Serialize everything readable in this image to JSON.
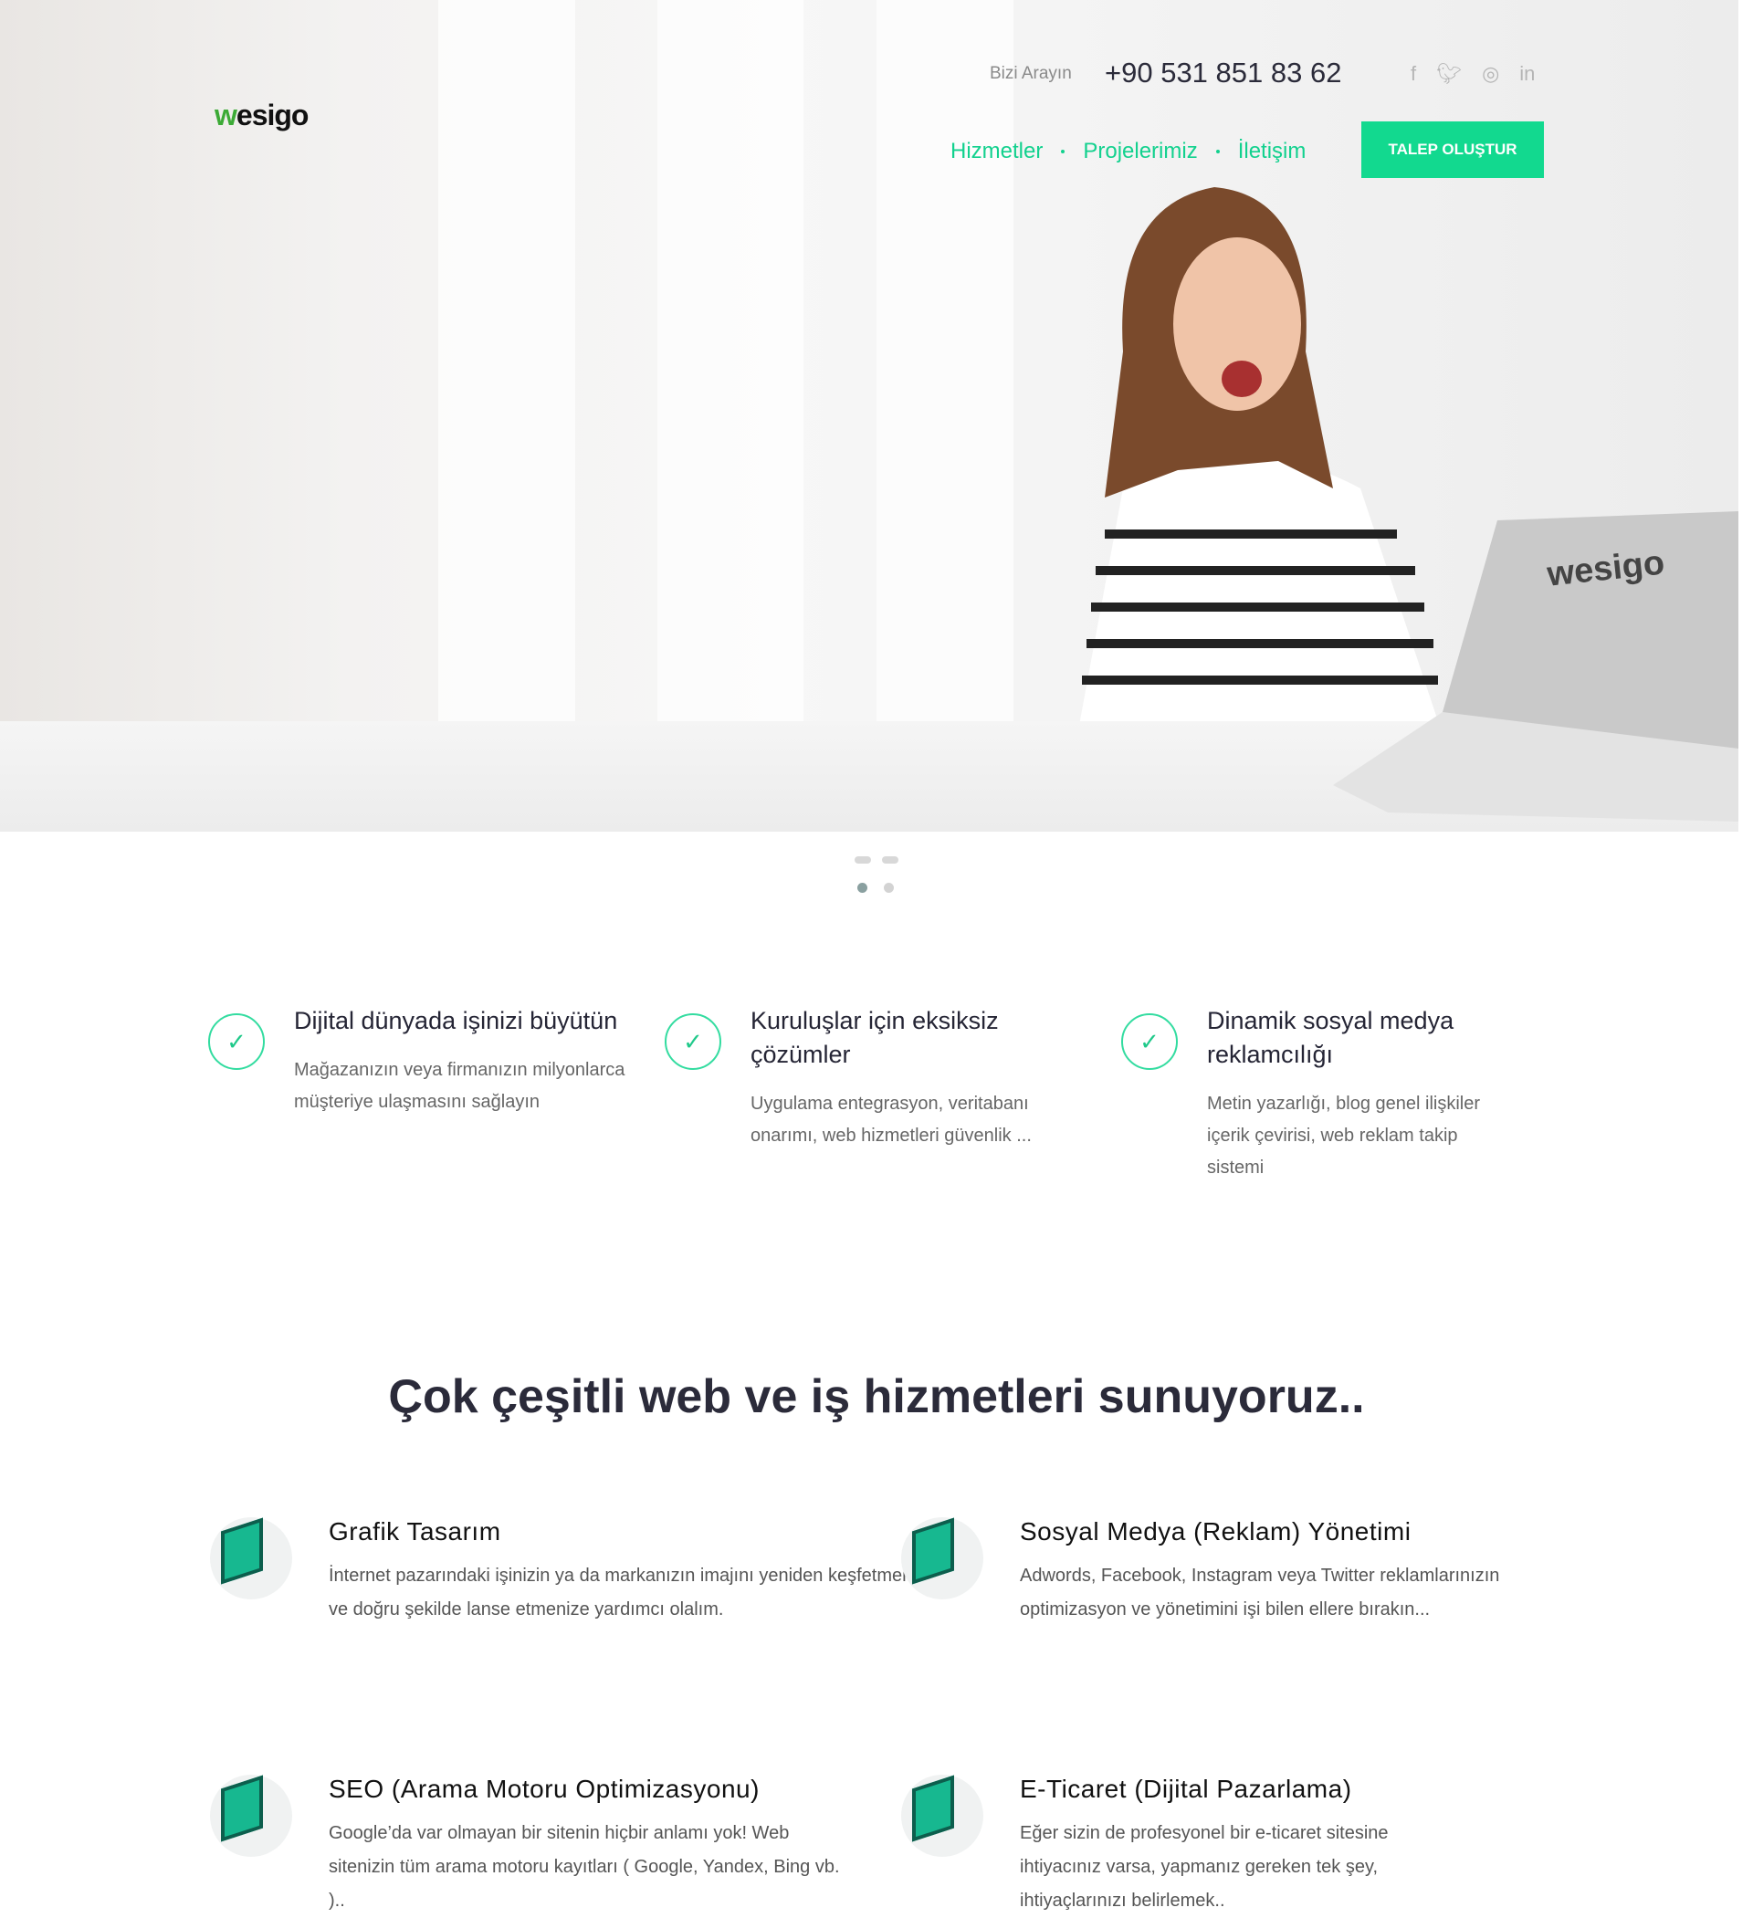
{
  "header": {
    "logo": "wesigo",
    "logo_first": "w",
    "logo_rest": "esigo",
    "call_label": "Bizi Arayın",
    "phone": "+90 531 851 83 62",
    "social": [
      "facebook-icon",
      "twitter-icon",
      "instagram-icon",
      "linkedin-icon"
    ],
    "nav": [
      "Hizmetler",
      "Projelerimiz",
      "İletişim"
    ],
    "cta": "TALEP OLUŞTUR"
  },
  "hero": {
    "laptop_brand": "wesigo",
    "slide_count": 2,
    "active_slide": 1
  },
  "features": [
    {
      "title": "Dijital dünyada işinizi büyütün",
      "text": "Mağazanızın veya firmanızın milyonlarca müşteriye ulaşmasını sağlayın"
    },
    {
      "title": "Kuruluşlar için eksiksiz çözümler",
      "text": "Uygulama entegrasyon, veritabanı onarımı, web hizmetleri güvenlik ..."
    },
    {
      "title": "Dinamik sosyal medya reklamcılığı",
      "text": "Metin yazarlığı, blog genel ilişkiler içerik çevirisi, web reklam takip sistemi"
    }
  ],
  "services_heading": "Çok çeşitli web ve iş hizmetleri sunuyoruz..",
  "services": [
    {
      "title": "Grafik Tasarım",
      "text": "İnternet pazarındaki işinizin ya da markanızın imajını yeniden keşfetmenize ve doğru şekilde lanse etmenize yardımcı olalım."
    },
    {
      "title": "Sosyal Medya (Reklam) Yönetimi",
      "text": "Adwords, Facebook, Instagram veya Twitter reklamlarınızın optimizasyon ve yönetimini işi bilen ellere bırakın..."
    },
    {
      "title": "SEO (Arama Motoru Optimizasyonu)",
      "text": "Google’da var olmayan bir sitenin hiçbir anlamı yok! Web sitenizin tüm arama motoru kayıtları ( Google, Yandex, Bing vb. ).."
    },
    {
      "title": "E-Ticaret (Dijital Pazarlama)",
      "text": "Eğer sizin de profesyonel bir e-ticaret sitesine ihtiyacınız varsa, yapmanız gereken tek şey, ihtiyaçlarınızı belirlemek.."
    }
  ],
  "colors": {
    "accent": "#12d98f",
    "text": "#2b2b3a"
  }
}
